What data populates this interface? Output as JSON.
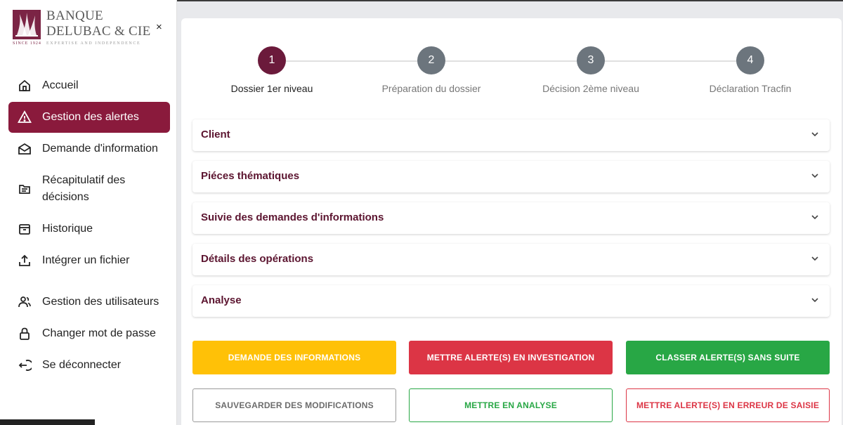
{
  "logo": {
    "line1": "BANQUE",
    "line2": "DELUBAC & CIE",
    "since": "SINCE 1924",
    "tagline": "EXPERTISE AND INDEPENDENCE",
    "brand_color": "#7b2445"
  },
  "sidebar": {
    "close_label": "×",
    "items": [
      {
        "label": "Accueil",
        "icon": "home-icon"
      },
      {
        "label": "Gestion des alertes",
        "icon": "warning-icon"
      },
      {
        "label": "Demande d'information",
        "icon": "mail-open-icon"
      },
      {
        "label": "Récapitulatif des décisions",
        "icon": "folders-icon"
      },
      {
        "label": "Historique",
        "icon": "archive-icon"
      },
      {
        "label": "Intégrer un fichier",
        "icon": "upload-icon"
      },
      {
        "label": "Gestion des utilisateurs",
        "icon": "users-icon"
      },
      {
        "label": "Changer mot de passe",
        "icon": "lock-icon"
      },
      {
        "label": "Se déconnecter",
        "icon": "logout-icon"
      }
    ],
    "active_color": "#8a1a3c"
  },
  "stepper": {
    "steps": [
      {
        "number": "1",
        "label": "Dossier 1er niveau",
        "active": true
      },
      {
        "number": "2",
        "label": "Préparation du dossier",
        "active": false
      },
      {
        "number": "3",
        "label": "Décision 2ème niveau",
        "active": false
      },
      {
        "number": "4",
        "label": "Déclaration Tracfin",
        "active": false
      }
    ]
  },
  "accordion": [
    {
      "title": "Client"
    },
    {
      "title": "Piéces thématiques"
    },
    {
      "title": "Suivie des demandes d'informations"
    },
    {
      "title": "Détails des opérations"
    },
    {
      "title": "Analyse"
    }
  ],
  "actions": {
    "request_info": "DEMANDE DES INFORMATIONS",
    "investigate": "METTRE ALERTE(S) EN INVESTIGATION",
    "close_no_action": "CLASSER ALERTE(S) SANS SUITE",
    "save_changes": "SAUVEGARDER DES MODIFICATIONS",
    "set_analysis": "METTRE EN ANALYSE",
    "input_error": "METTRE ALERTE(S) EN ERREUR DE SAISIE"
  }
}
